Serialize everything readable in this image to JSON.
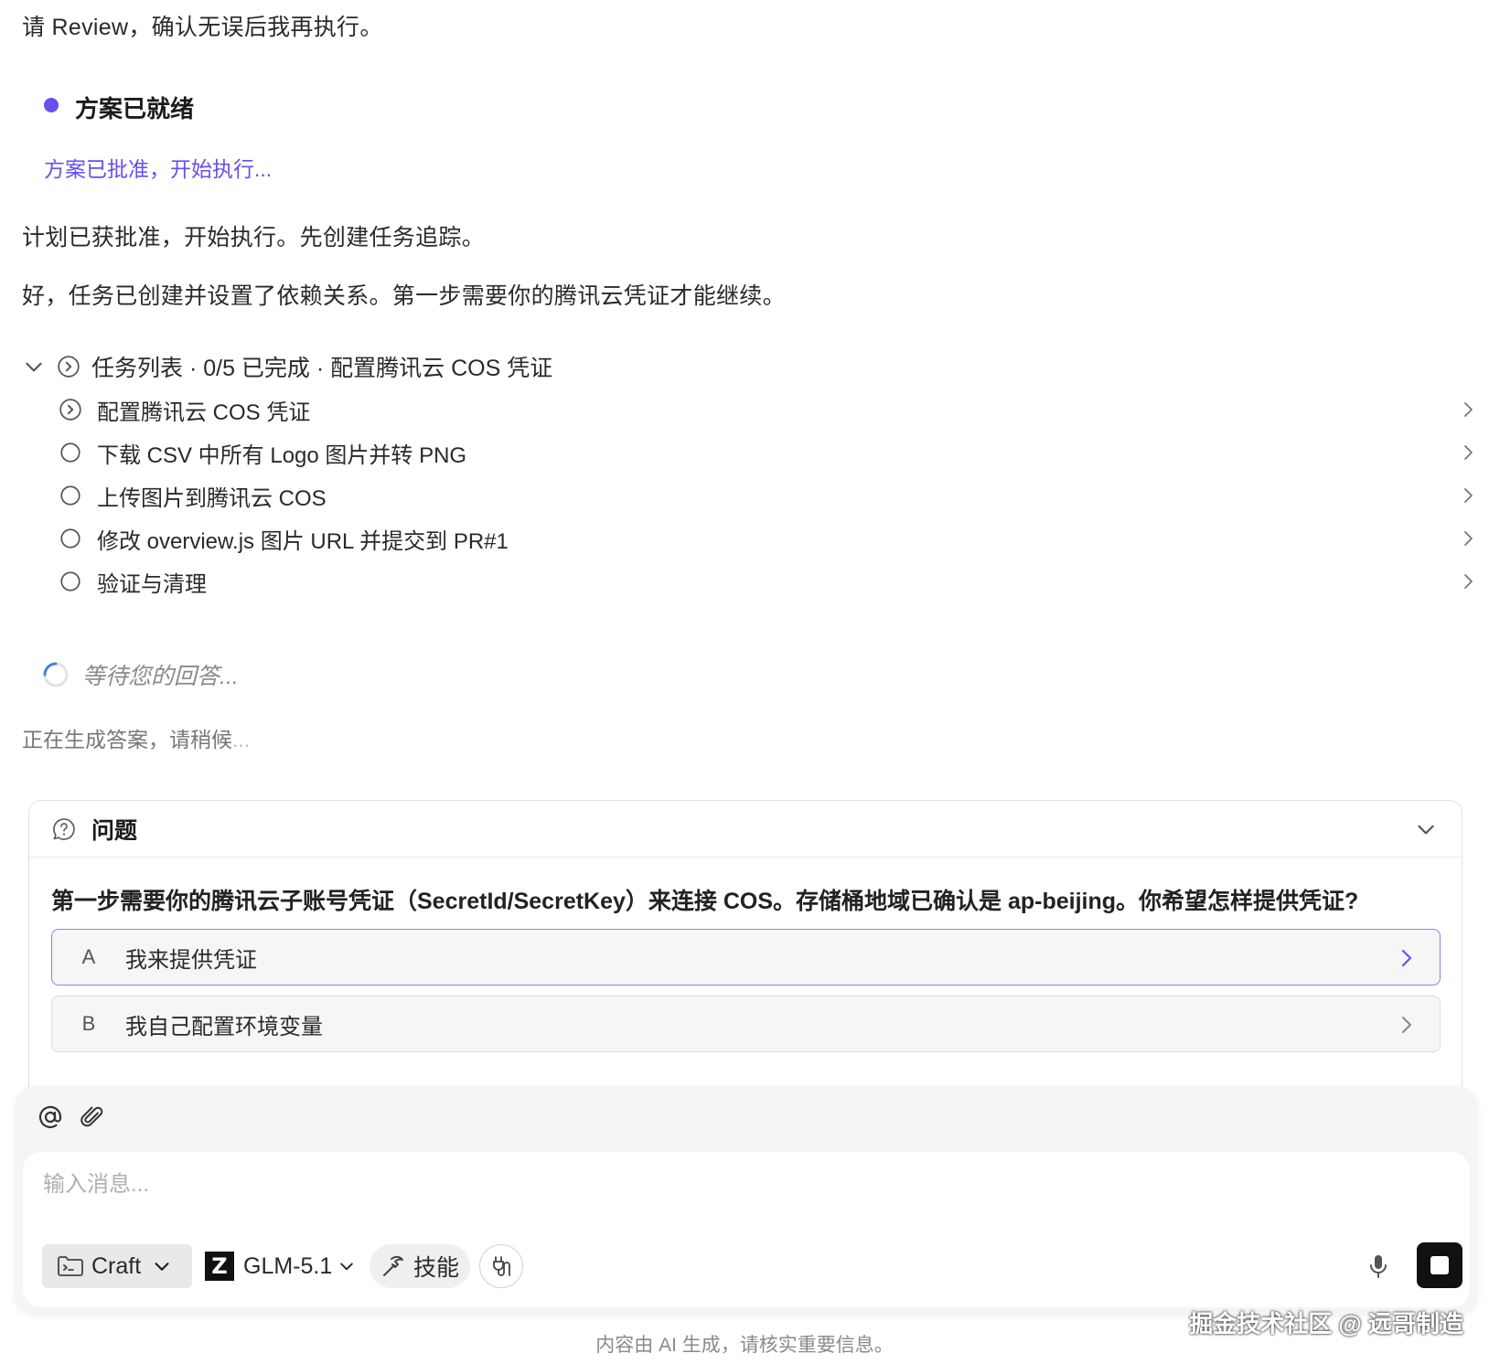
{
  "chat": {
    "review_line": "请 Review，确认无误后我再执行。",
    "plan_status": "方案已就绪",
    "plan_approved": "方案已批准，开始执行...",
    "line_approved": "计划已获批准，开始执行。先创建任务追踪。",
    "line_tasks_created": "好，任务已创建并设置了依赖关系。第一步需要你的腾讯云凭证才能继续。"
  },
  "tasks": {
    "header": "任务列表 · 0/5 已完成 · 配置腾讯云 COS 凭证",
    "items": [
      {
        "label": "配置腾讯云 COS 凭证",
        "state": "in-progress"
      },
      {
        "label": "下载 CSV 中所有 Logo 图片并转 PNG",
        "state": "pending"
      },
      {
        "label": "上传图片到腾讯云 COS",
        "state": "pending"
      },
      {
        "label": "修改 overview.js 图片 URL 并提交到 PR#1",
        "state": "pending"
      },
      {
        "label": "验证与清理",
        "state": "pending"
      }
    ]
  },
  "waiting": {
    "label": "等待您的回答...",
    "generating": "正在生成答案，请稍候",
    "generating_dots": "..."
  },
  "question": {
    "title": "问题",
    "text": "第一步需要你的腾讯云子账号凭证（SecretId/SecretKey）来连接 COS。存储桶地域已确认是 ap-beijing。你希望怎样提供凭证?",
    "options": [
      {
        "key": "A",
        "label": "我来提供凭证"
      },
      {
        "key": "B",
        "label": "我自己配置环境变量"
      }
    ]
  },
  "composer": {
    "placeholder": "输入消息...",
    "mode": "Craft",
    "model": "GLM-5.1",
    "model_logo": "Z",
    "skills": "技能"
  },
  "footer": {
    "disclaimer": "内容由 AI 生成，请核实重要信息。",
    "watermark": "掘金技术社区 @ 远哥制造"
  },
  "colors": {
    "accent": "#6a4ff0",
    "option_selected_border": "#8d7ff2"
  }
}
